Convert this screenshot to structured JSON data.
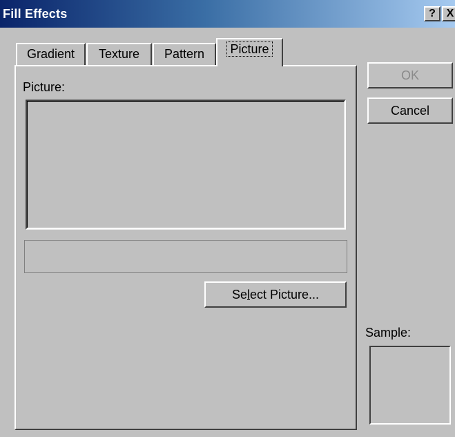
{
  "window": {
    "title": "Fill Effects",
    "help_label": "?",
    "close_label": "X"
  },
  "tabs": [
    {
      "label": "Gradient",
      "active": false
    },
    {
      "label": "Texture",
      "active": false
    },
    {
      "label": "Pattern",
      "active": false
    },
    {
      "label": "Picture",
      "active": true
    }
  ],
  "picture_panel": {
    "picture_label": "Picture:",
    "picture_name_value": "",
    "select_button_prefix": "Se",
    "select_button_accel": "l",
    "select_button_suffix": "ect Picture..."
  },
  "buttons": {
    "ok": "OK",
    "cancel": "Cancel"
  },
  "sample": {
    "label": "Sample:"
  }
}
